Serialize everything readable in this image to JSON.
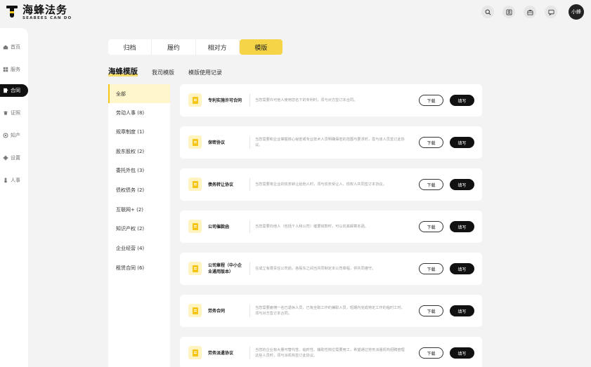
{
  "brand": {
    "title": "海蜂法务",
    "subtitle": "SEABEES CAN DO"
  },
  "header": {
    "icons": [
      "search-icon",
      "contact-icon",
      "briefcase-icon",
      "message-icon"
    ],
    "avatar_label": "小蜂"
  },
  "sidebar": {
    "items": [
      {
        "label": "首页",
        "icon": "home-icon"
      },
      {
        "label": "服务",
        "icon": "grid-icon"
      },
      {
        "label": "合同",
        "icon": "contract-icon",
        "active": true
      },
      {
        "label": "证照",
        "icon": "license-icon"
      },
      {
        "label": "知产",
        "icon": "ip-icon"
      },
      {
        "label": "设置",
        "icon": "gear-icon"
      },
      {
        "label": "人事",
        "icon": "person-icon"
      }
    ]
  },
  "tabs": [
    "归档",
    "履约",
    "相对方",
    "模版"
  ],
  "active_tab": "模版",
  "subtabs": [
    "海蜂模版",
    "我司模版",
    "模版使用记录"
  ],
  "categories": [
    "全部",
    "劳动人事 (8)",
    "规章制度 (1)",
    "股东股权 (2)",
    "委托外包 (3)",
    "债权债务 (2)",
    "互联网+ (2)",
    "知识产权 (2)",
    "企业经营 (4)",
    "租赁合同 (6)"
  ],
  "buttons": {
    "download": "下载",
    "fill": "填写"
  },
  "templates": [
    {
      "title": "专利实施许可合同",
      "desc": "当您需要许可他人使用您名下的专利时，须与对方签订本合同。"
    },
    {
      "title": "保密协议",
      "desc": "当您需要和企业掌握核心秘密或专业技术人员明确保密的范围与要求时，需与该人员签订此协议。"
    },
    {
      "title": "债务转让协议",
      "desc": "当您需要将企业的债务转让给他人时，须与债务受让人、债权人共同签订本协议。"
    },
    {
      "title": "公司催款函",
      "desc": "当您需要向他人（包括个人和公司）催要钱款时，可以向其邮寄本函。"
    },
    {
      "title": "公司章程（中小企业通用版本）",
      "desc": "在成立有限责任公司前，各股东之间当共同制定本公司章程，供共同遵守。"
    },
    {
      "title": "劳务合同",
      "desc": "当您需要雇佣一名已退休人员、已有全职工作的兼职人员，短期内完成特定工作的临时工时，须与对方签订本合同。"
    },
    {
      "title": "劳务派遣协议",
      "desc": "当您的企业有大量可替代性、临时性、辅助性岗位需要用工，希望通过劳务派遣机构招聘管理这些人员时，须与派机构签订此协议。"
    }
  ]
}
